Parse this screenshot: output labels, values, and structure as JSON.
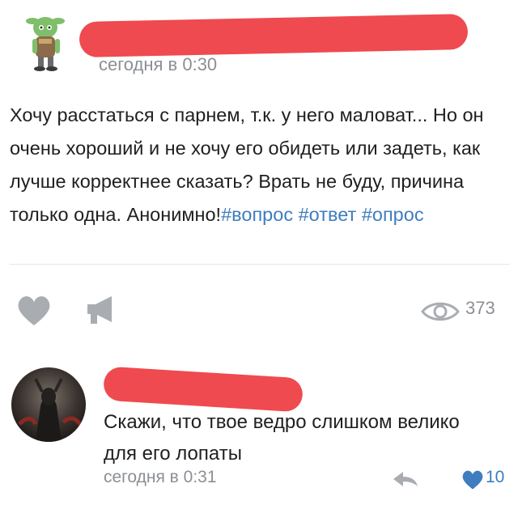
{
  "post": {
    "timestamp": "сегодня в 0:30",
    "text_main": "Хочу расстаться с парнем, т.к. у него маловат... Но он очень хороший и не хочу его обидеть или задеть, как лучше корректнее сказать? Врать не буду, причина только одна. Анонимно!",
    "hashtags": [
      "#вопрос",
      "#ответ",
      "#опрос"
    ],
    "avatar_icon": "cartoon-character-avatar",
    "actions": {
      "like_icon": "heart-icon",
      "share_icon": "megaphone-icon",
      "views_icon": "eye-icon",
      "views_count": "373"
    }
  },
  "comment": {
    "text": "Скажи, что твое ведро слишком велико для его лопаты",
    "timestamp": "сегодня в 0:31",
    "reply_icon": "reply-arrow-icon",
    "like_icon": "heart-icon",
    "likes_count": "10",
    "avatar_icon": "dark-figure-avatar"
  },
  "colors": {
    "redaction": "#ef4a4f",
    "hashtag": "#3f7dbf",
    "secondary_text": "#8b8f94",
    "icon_gray": "#a9adb2",
    "liked_heart": "#3f7dbf"
  }
}
